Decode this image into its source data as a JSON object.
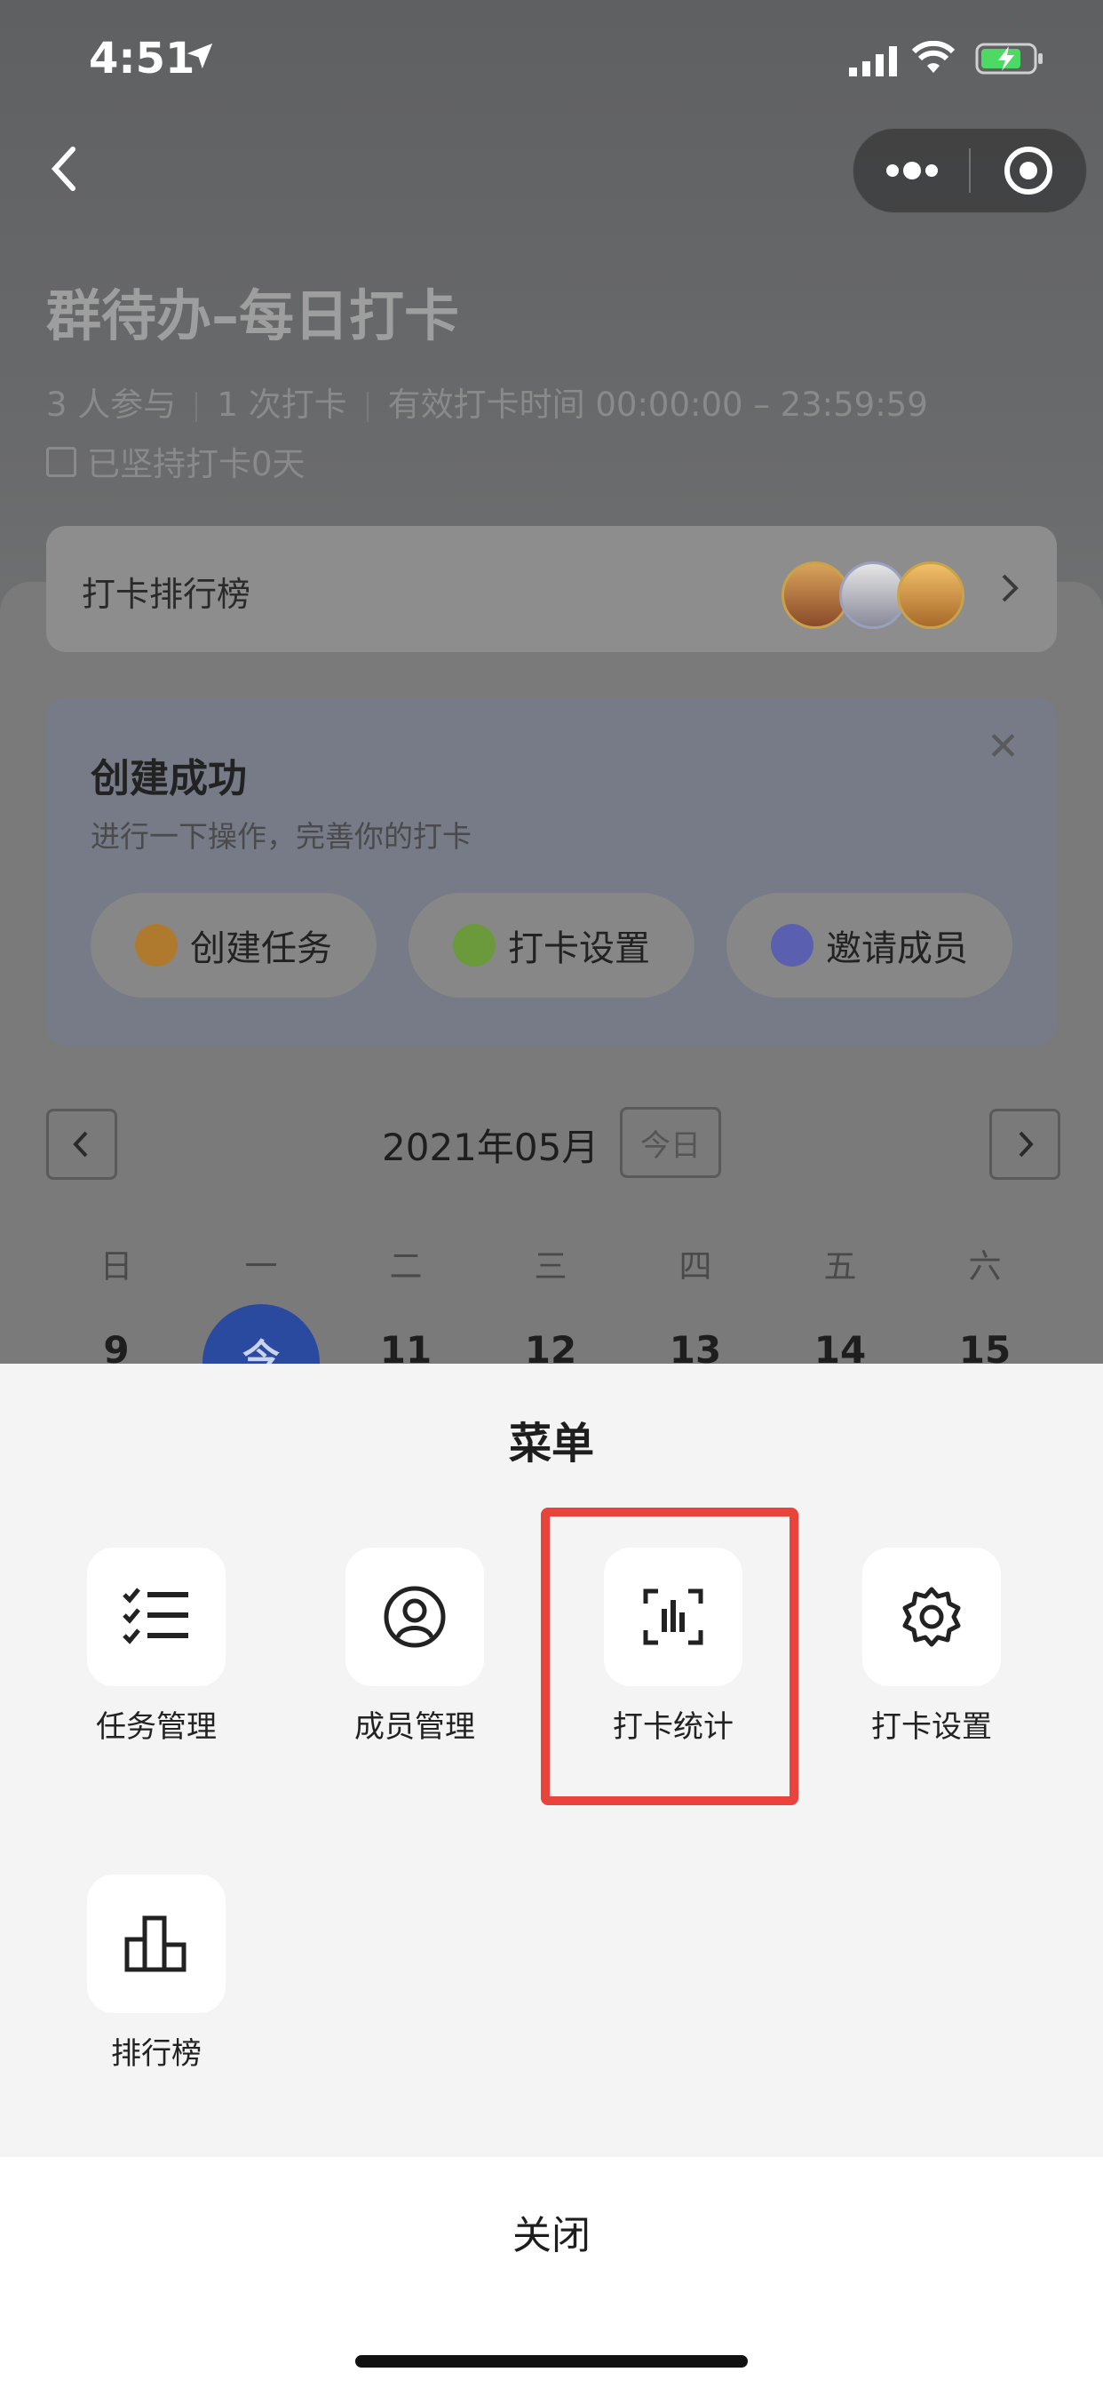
{
  "status_bar": {
    "time": "4:51"
  },
  "page": {
    "title": "群待办–每日打卡",
    "meta": [
      "3 人参与",
      "1 次打卡",
      "有效打卡时间 00:00:00 – 23:59:59"
    ],
    "persist": "已坚持打卡0天"
  },
  "ranking": {
    "label": "打卡排行榜"
  },
  "success_card": {
    "heading": "创建成功",
    "subtitle": "进行一下操作，完善你的打卡",
    "actions": [
      "创建任务",
      "打卡设置",
      "邀请成员"
    ],
    "action_colors": [
      "#b07a2e",
      "#6a9a3c",
      "#5a5fb0"
    ]
  },
  "calendar": {
    "month": "2021年05月",
    "today_button": "今日",
    "weekdays": [
      "日",
      "一",
      "二",
      "三",
      "四",
      "五",
      "六"
    ],
    "days": [
      "9",
      "今",
      "11",
      "12",
      "13",
      "14",
      "15"
    ],
    "today_color": "#2a4aa0"
  },
  "menu": {
    "title": "菜单",
    "items": [
      "任务管理",
      "成员管理",
      "打卡统计",
      "打卡设置",
      "排行榜"
    ],
    "icons": [
      "task-list-icon",
      "member-icon",
      "stats-icon",
      "gear-icon",
      "bar-chart-icon"
    ],
    "highlight_color": "#e8443c"
  },
  "close_label": "关闭"
}
